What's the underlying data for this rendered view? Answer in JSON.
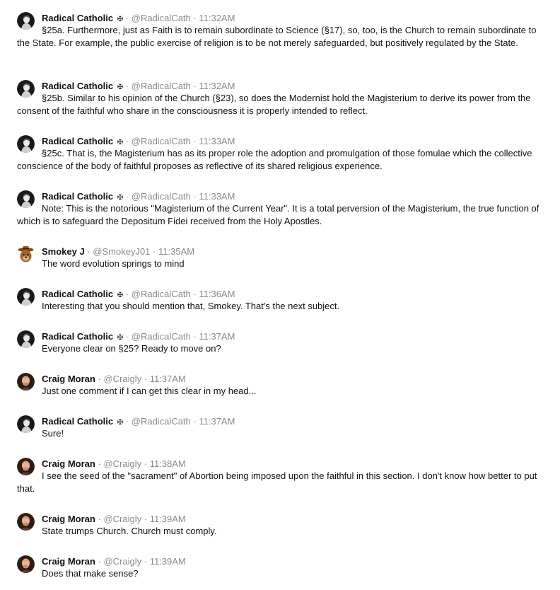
{
  "messages": [
    {
      "author": "Radical Catholic",
      "badge": "✠",
      "handle": "@RadicalCath",
      "time": "11:32AM",
      "avatar": "radical-catholic-avatar",
      "text": "§25a. Furthermore, just as Faith is to remain subordinate to Science (§17), so, too, is the Church to remain subordinate to the State. For example, the public exercise of religion is to be not merely safeguarded, but positively regulated by the State."
    },
    {
      "author": "Radical Catholic",
      "badge": "✠",
      "handle": "@RadicalCath",
      "time": "11:32AM",
      "avatar": "radical-catholic-avatar",
      "text": "§25b. Similar to his opinion of the Church (§23), so does the Modernist hold the Magisterium to derive its power from the consent of the faithful who share in the consciousness it is properly intended to reflect."
    },
    {
      "author": "Radical Catholic",
      "badge": "✠",
      "handle": "@RadicalCath",
      "time": "11:33AM",
      "avatar": "radical-catholic-avatar",
      "text": "§25c. That is, the Magisterium has as its proper role the adoption and promulgation of those fomulae which the collective conscience of the body of faithful proposes as reflective of its shared religious experience."
    },
    {
      "author": "Radical Catholic",
      "badge": "✠",
      "handle": "@RadicalCath",
      "time": "11:33AM",
      "avatar": "radical-catholic-avatar",
      "text": "Note: This is the notorious \"Magisterium of the Current Year\". It is a total perversion of the Magisterium, the true function of which is to safeguard the Depositum Fidei received from the Holy Apostles."
    },
    {
      "author": "Smokey J",
      "badge": "",
      "handle": "@SmokeyJ01",
      "time": "11:35AM",
      "avatar": "smokey-bear-avatar",
      "text": "The word evolution springs to mind"
    },
    {
      "author": "Radical Catholic",
      "badge": "✠",
      "handle": "@RadicalCath",
      "time": "11:36AM",
      "avatar": "radical-catholic-avatar",
      "text": "Interesting that you should mention that, Smokey. That's the next subject."
    },
    {
      "author": "Radical Catholic",
      "badge": "✠",
      "handle": "@RadicalCath",
      "time": "11:37AM",
      "avatar": "radical-catholic-avatar",
      "text": "Everyone clear on §25? Ready to move on?"
    },
    {
      "author": "Craig Moran",
      "badge": "",
      "handle": "@Craigly",
      "time": "11:37AM",
      "avatar": "craig-moran-avatar",
      "text": "Just one comment if I can get this clear in my head..."
    },
    {
      "author": "Radical Catholic",
      "badge": "✠",
      "handle": "@RadicalCath",
      "time": "11:37AM",
      "avatar": "radical-catholic-avatar",
      "text": "Sure!"
    },
    {
      "author": "Craig Moran",
      "badge": "",
      "handle": "@Craigly",
      "time": "11:38AM",
      "avatar": "craig-moran-avatar",
      "text": "I see the seed of the \"sacrament\" of Abortion being imposed upon the faithful in this section. I don't know how better to put that."
    },
    {
      "author": "Craig Moran",
      "badge": "",
      "handle": "@Craigly",
      "time": "11:39AM",
      "avatar": "craig-moran-avatar",
      "text": "State trumps Church. Church must comply."
    },
    {
      "author": "Craig Moran",
      "badge": "",
      "handle": "@Craigly",
      "time": "11:39AM",
      "avatar": "craig-moran-avatar",
      "text": "Does that make sense?"
    }
  ],
  "separator": "·",
  "colors": {
    "text": "#111111",
    "meta": "#8a8a8a",
    "background": "#ffffff"
  }
}
